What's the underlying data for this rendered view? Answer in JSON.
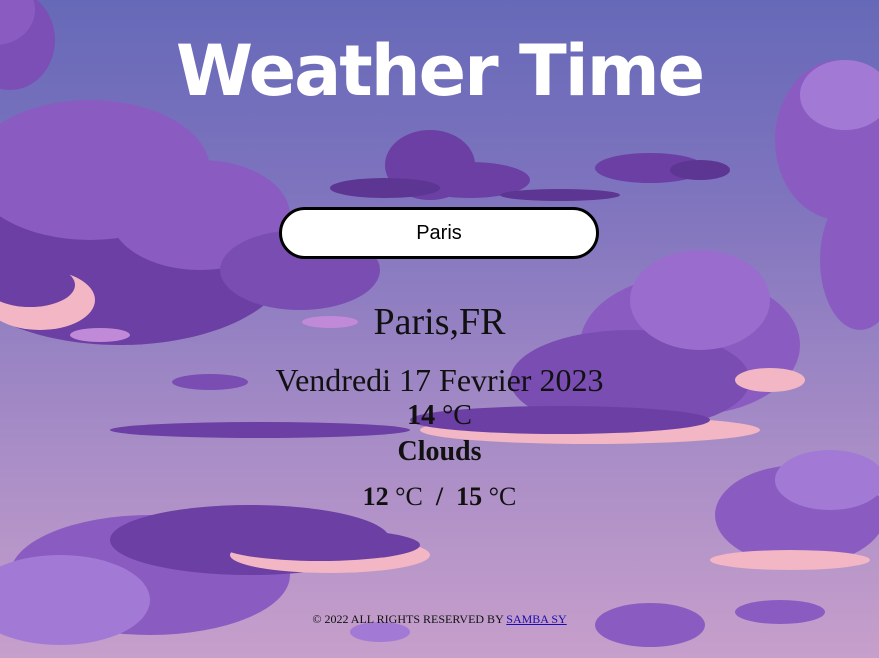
{
  "app": {
    "title": "Weather Time"
  },
  "search": {
    "value": "Paris",
    "placeholder": ""
  },
  "weather": {
    "location": "Paris,FR",
    "date": "Vendredi 17 Fevrier 2023",
    "temp_value": "14",
    "temp_unit": "°C",
    "description": "Clouds",
    "min_value": "12",
    "min_unit": "°C",
    "separator": "/",
    "max_value": "15",
    "max_unit": "°C"
  },
  "footer": {
    "text": "© 2022 ALL RIGHTS RESERVED BY",
    "link_text": "SAMBA SY"
  },
  "colors": {
    "sky_top": "#6669b8",
    "sky_bottom": "#c79fcb",
    "cloud_dark": "#6b3fa3",
    "cloud_mid": "#8a5cc2",
    "cloud_light": "#a27ad6",
    "cloud_highlight": "#f2b6c4"
  }
}
